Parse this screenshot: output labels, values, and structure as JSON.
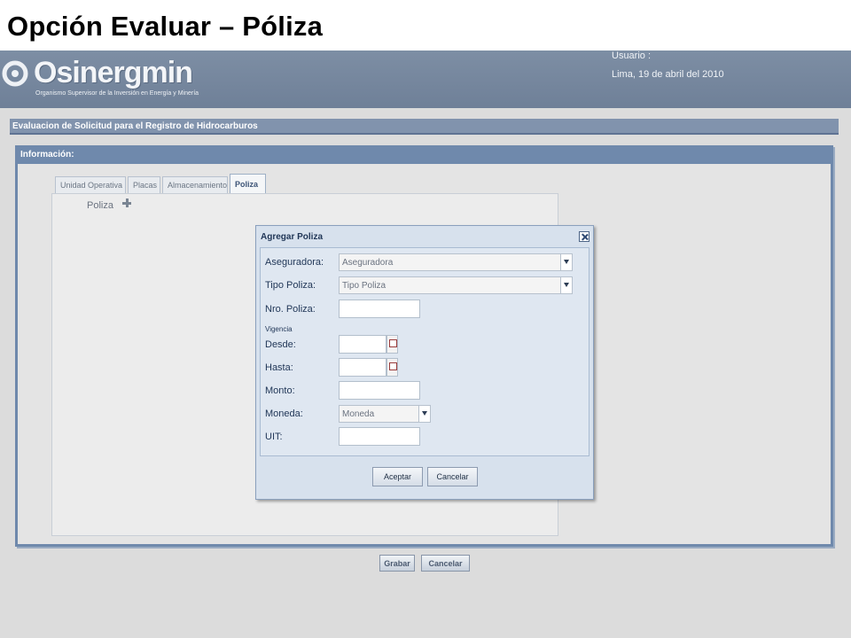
{
  "slide_title": "Opción Evaluar – Póliza",
  "banner": {
    "logo_text": "Osinergmin",
    "logo_subtitle": "Organismo Supervisor de la Inversión en Energía y Minería",
    "user_label": "Usuario :",
    "date_label": "Lima, 19 de abril del 2010"
  },
  "page_header": "Evaluacion de Solicitud para el Registro de Hidrocarburos",
  "panel": {
    "title": "Información:",
    "tabs": [
      {
        "label": "Unidad Operativa",
        "active": false
      },
      {
        "label": "Placas",
        "active": false
      },
      {
        "label": "Almacenamiento",
        "active": false
      },
      {
        "label": "Poliza",
        "active": true
      }
    ],
    "section_label": "Poliza",
    "add_icon": "plus-icon"
  },
  "main_buttons": {
    "save": "Grabar",
    "cancel": "Cancelar"
  },
  "dialog": {
    "title": "Agregar Poliza",
    "close_icon": "close-icon",
    "fields": {
      "aseguradora": {
        "label": "Aseguradora:",
        "value": "Aseguradora"
      },
      "tipo_poliza": {
        "label": "Tipo Poliza:",
        "value": "Tipo Poliza"
      },
      "nro_poliza": {
        "label": "Nro. Poliza:",
        "value": ""
      },
      "vigencia": {
        "label": "Vigencia"
      },
      "desde": {
        "label": "Desde:",
        "value": ""
      },
      "hasta": {
        "label": "Hasta:",
        "value": ""
      },
      "monto": {
        "label": "Monto:",
        "value": ""
      },
      "moneda": {
        "label": "Moneda:",
        "value": "Moneda"
      },
      "uit": {
        "label": "UIT:",
        "value": ""
      }
    },
    "buttons": {
      "accept": "Aceptar",
      "cancel": "Cancelar"
    }
  },
  "colors": {
    "banner": "#7d8ea4",
    "panel_border": "#6f89ac",
    "dialog_bg": "#d7e1ed",
    "label_text": "#1f3556"
  }
}
